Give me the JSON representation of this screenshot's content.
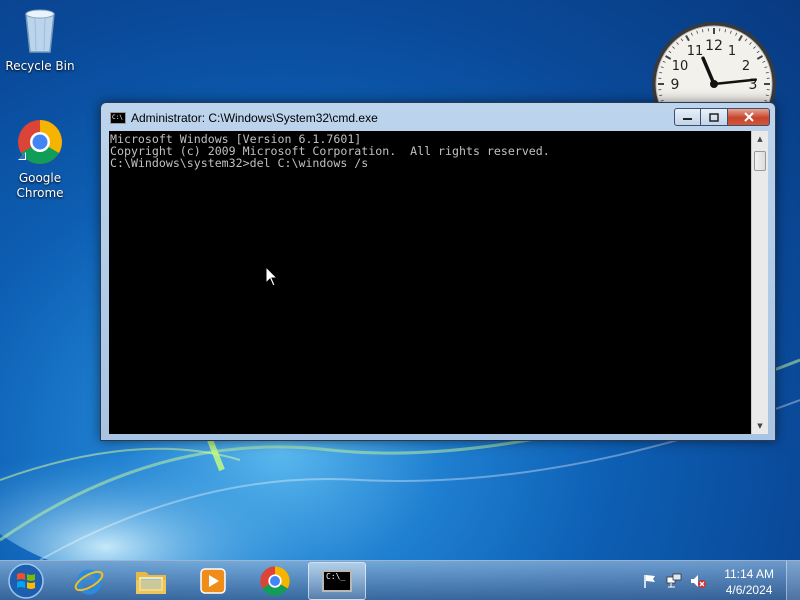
{
  "desktop": {
    "icons": [
      {
        "label": "Recycle Bin",
        "icon": "recycle-bin-icon"
      },
      {
        "label": "Google Chrome",
        "icon": "chrome-icon"
      }
    ]
  },
  "clock": {
    "numerals": [
      "12",
      "1",
      "2",
      "3",
      "9",
      "10",
      "11"
    ],
    "hour": 11,
    "minute": 14
  },
  "window": {
    "title": "Administrator: C:\\Windows\\System32\\cmd.exe",
    "icon_text": "C:\\",
    "console_lines": [
      "Microsoft Windows [Version 6.1.7601]",
      "Copyright (c) 2009 Microsoft Corporation.  All rights reserved.",
      "",
      "C:\\Windows\\system32>del C:\\windows /s"
    ],
    "minimize_icon": "minimize-icon",
    "maximize_icon": "maximize-icon",
    "close_icon": "close-icon"
  },
  "taskbar": {
    "start_icon": "windows-start-icon",
    "pinned": [
      {
        "name": "internet-explorer",
        "icon": "internet-explorer-icon"
      },
      {
        "name": "windows-explorer",
        "icon": "folder-icon"
      },
      {
        "name": "windows-media-player",
        "icon": "media-player-icon"
      },
      {
        "name": "google-chrome",
        "icon": "chrome-icon"
      },
      {
        "name": "command-prompt",
        "icon": "cmd-icon",
        "active": true
      }
    ],
    "cmd_icon_text": "C:\\_",
    "tray": {
      "icons": [
        "action-center-flag-icon",
        "network-icon",
        "volume-muted-icon"
      ],
      "time": "11:14 AM",
      "date": "4/6/2024"
    }
  },
  "colors": {
    "console_bg": "#000000",
    "console_text": "#c0c0c0",
    "close_button": "#c6452c"
  }
}
